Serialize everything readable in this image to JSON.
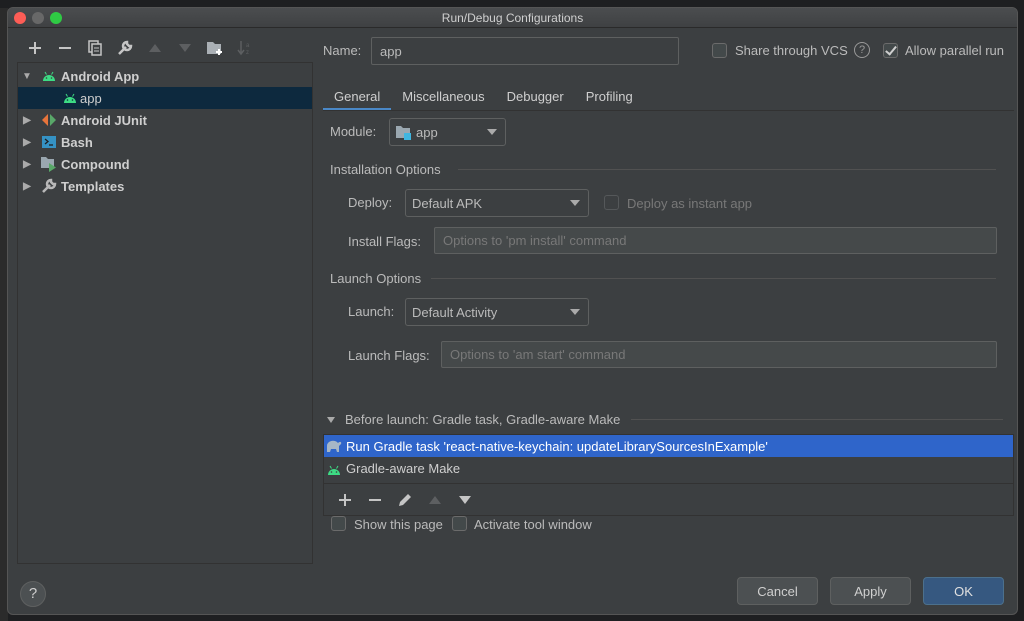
{
  "window": {
    "title": "Run/Debug Configurations"
  },
  "left_toolbar": {
    "icons": [
      "add-icon",
      "remove-icon",
      "copy-icon",
      "wrench-icon",
      "move-up-icon",
      "move-down-icon",
      "new-folder-icon",
      "sort-icon"
    ]
  },
  "tree": {
    "items": [
      {
        "label": "Android App",
        "icon": "android-icon",
        "expanded": true,
        "level": 0
      },
      {
        "label": "app",
        "icon": "android-icon",
        "selected": true,
        "level": 1
      },
      {
        "label": "Android JUnit",
        "icon": "junit-icon",
        "expanded": false,
        "level": 0
      },
      {
        "label": "Bash",
        "icon": "terminal-icon",
        "expanded": false,
        "level": 0
      },
      {
        "label": "Compound",
        "icon": "compound-icon",
        "expanded": false,
        "level": 0
      },
      {
        "label": "Templates",
        "icon": "wrench-icon",
        "expanded": false,
        "level": 0
      }
    ]
  },
  "header": {
    "name_label": "Name:",
    "name_value": "app",
    "share_vcs_label": "Share through VCS",
    "share_vcs_checked": false,
    "allow_parallel_label": "Allow parallel run",
    "allow_parallel_checked": true
  },
  "tabs": [
    {
      "label": "General",
      "active": true
    },
    {
      "label": "Miscellaneous",
      "active": false
    },
    {
      "label": "Debugger",
      "active": false
    },
    {
      "label": "Profiling",
      "active": false
    }
  ],
  "general": {
    "module_label": "Module:",
    "module_value": "app",
    "installation_title": "Installation Options",
    "deploy_label": "Deploy:",
    "deploy_value": "Default APK",
    "instant_app_label": "Deploy as instant app",
    "instant_app_checked": false,
    "install_flags_label": "Install Flags:",
    "install_flags_placeholder": "Options to 'pm install' command",
    "install_flags_value": "",
    "launch_title": "Launch Options",
    "launch_label": "Launch:",
    "launch_value": "Default Activity",
    "launch_flags_label": "Launch Flags:",
    "launch_flags_placeholder": "Options to 'am start' command",
    "launch_flags_value": ""
  },
  "before_launch": {
    "title": "Before launch: Gradle task, Gradle-aware Make",
    "items": [
      {
        "label": "Run Gradle task 'react-native-keychain: updateLibrarySourcesInExample'",
        "icon": "gradle-icon",
        "selected": true
      },
      {
        "label": "Gradle-aware Make",
        "icon": "android-icon",
        "selected": false
      }
    ],
    "show_page_label": "Show this page",
    "show_page_checked": false,
    "activate_tool_label": "Activate tool window",
    "activate_tool_checked": false
  },
  "footer": {
    "help_label": "?",
    "cancel_label": "Cancel",
    "apply_label": "Apply",
    "ok_label": "OK"
  },
  "colors": {
    "accent": "#4a88c7",
    "selection_list": "#2f65ca",
    "selection_tree": "#0d293e",
    "primary_button": "#365880",
    "android_green": "#3ddc84"
  }
}
